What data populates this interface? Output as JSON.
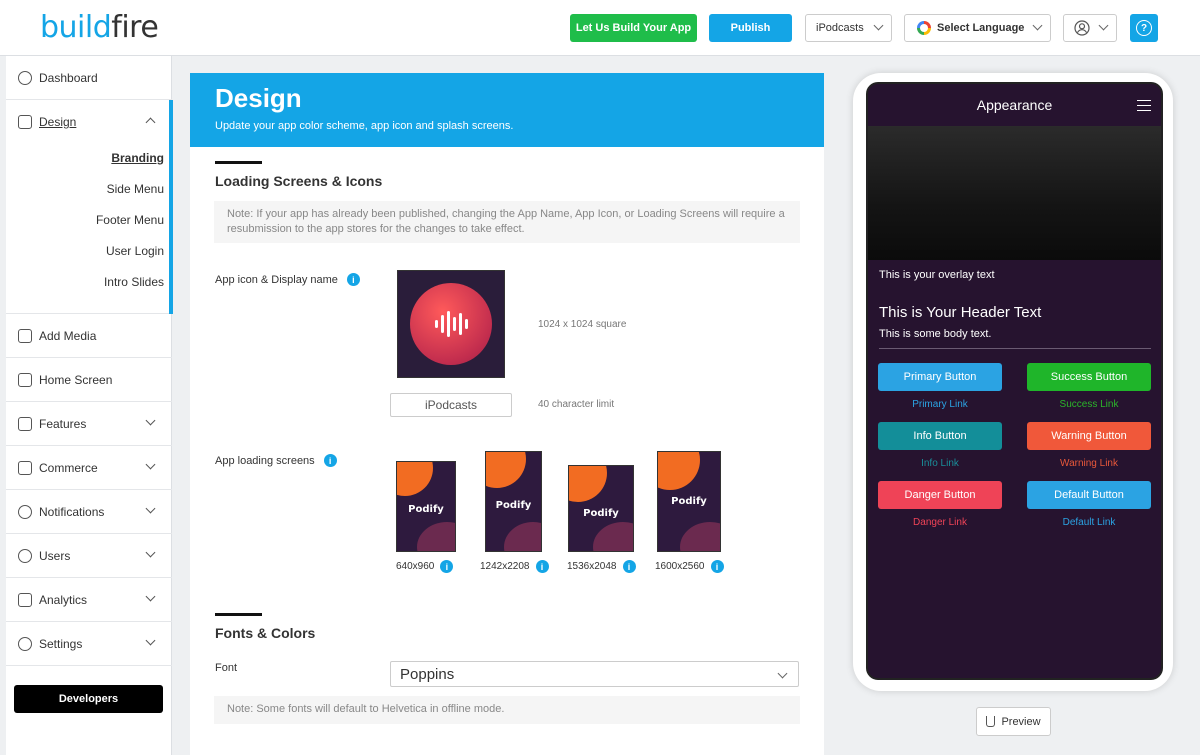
{
  "header": {
    "logo_left": "build",
    "logo_right": "fire",
    "build_btn": "Let Us Build Your App",
    "publish_btn": "Publish",
    "app_select": "iPodcasts",
    "language_select": "Select Language",
    "help": "?"
  },
  "sidebar": {
    "dashboard": "Dashboard",
    "design": "Design",
    "design_sub": [
      "Branding",
      "Side Menu",
      "Footer Menu",
      "User Login",
      "Intro Slides"
    ],
    "add_media": "Add Media",
    "home_screen": "Home Screen",
    "features": "Features",
    "commerce": "Commerce",
    "notifications": "Notifications",
    "users": "Users",
    "analytics": "Analytics",
    "settings": "Settings",
    "developers": "Developers"
  },
  "main": {
    "title": "Design",
    "subtitle": "Update your app color scheme, app icon and splash screens.",
    "section1": "Loading Screens & Icons",
    "note1": "Note: If your app has already been published, changing the App Name, App Icon, or Loading Screens will require a resubmission to the app stores for the changes to take effect.",
    "icon_label": "App icon & Display name",
    "icon_hint": "1024 x 1024 square",
    "display_name": "iPodcasts",
    "name_hint": "40 character limit",
    "loading_label": "App loading screens",
    "screens": [
      {
        "name": "Podify",
        "size": "640x960"
      },
      {
        "name": "Podify",
        "size": "1242x2208"
      },
      {
        "name": "Podify",
        "size": "1536x2048"
      },
      {
        "name": "Podify",
        "size": "1600x2560"
      }
    ],
    "section2": "Fonts & Colors",
    "font_label": "Font",
    "font_value": "Poppins",
    "note2": "Note: Some fonts will default to Helvetica in offline mode.",
    "info": "i"
  },
  "phone": {
    "title": "Appearance",
    "overlay": "This is your overlay text",
    "header": "This is Your Header Text",
    "body": "This is some body text.",
    "buttons": [
      {
        "label": "Primary Button",
        "link": "Primary Link",
        "color": "#2ba3e3",
        "link_color": "#2ba3e3"
      },
      {
        "label": "Success Button",
        "link": "Success Link",
        "color": "#1fb52a",
        "link_color": "#2bb52a"
      },
      {
        "label": "Info Button",
        "link": "Info Link",
        "color": "#138e99",
        "link_color": "#1a8e99"
      },
      {
        "label": "Warning Button",
        "link": "Warning Link",
        "color": "#f0583a",
        "link_color": "#e8583a"
      },
      {
        "label": "Danger Button",
        "link": "Danger Link",
        "color": "#ef4357",
        "link_color": "#ef4357"
      },
      {
        "label": "Default Button",
        "link": "Default Link",
        "color": "#2ba3e3",
        "link_color": "#2ba3e3"
      }
    ]
  },
  "preview_btn": "Preview"
}
